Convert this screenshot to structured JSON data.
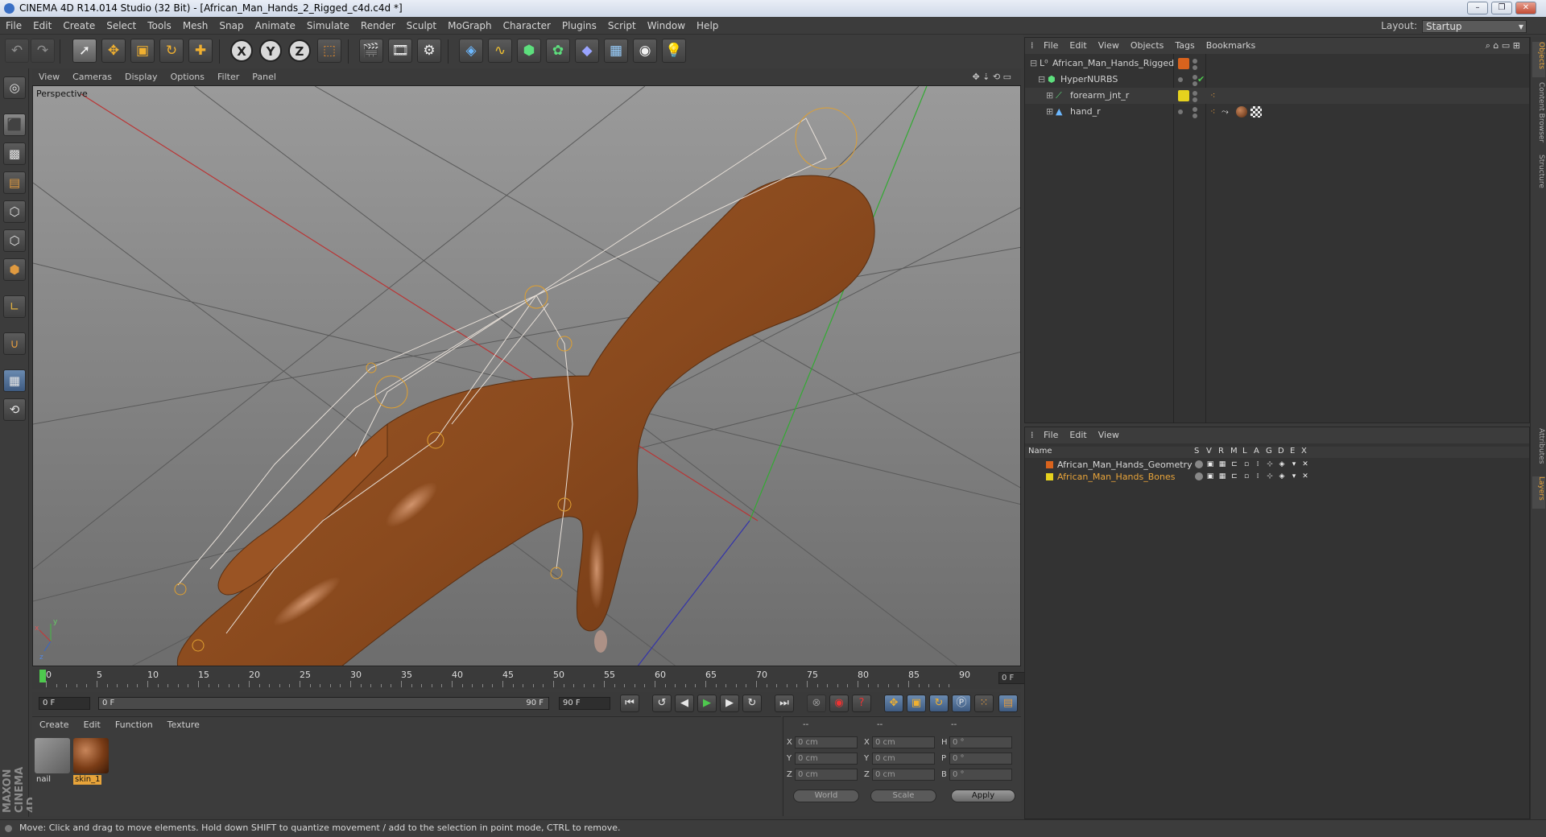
{
  "window": {
    "title": "CINEMA 4D R14.014 Studio (32 Bit) - [African_Man_Hands_2_Rigged_c4d.c4d *]",
    "minimize": "–",
    "maximize": "❐",
    "close": "✕"
  },
  "menubar": [
    "File",
    "Edit",
    "Create",
    "Select",
    "Tools",
    "Mesh",
    "Snap",
    "Animate",
    "Simulate",
    "Render",
    "Sculpt",
    "MoGraph",
    "Character",
    "Plugins",
    "Script",
    "Window",
    "Help"
  ],
  "layout": {
    "label": "Layout:",
    "value": "Startup"
  },
  "toolbar": {
    "x_axis": "X",
    "y_axis": "Y",
    "z_axis": "Z"
  },
  "viewport": {
    "menu": [
      "View",
      "Cameras",
      "Display",
      "Options",
      "Filter",
      "Panel"
    ],
    "label": "Perspective"
  },
  "timeline": {
    "ticks": [
      "0",
      "5",
      "10",
      "15",
      "20",
      "25",
      "30",
      "35",
      "40",
      "45",
      "50",
      "55",
      "60",
      "65",
      "70",
      "75",
      "80",
      "85",
      "90"
    ],
    "current_frame": "0 F"
  },
  "transport": {
    "start": "0 F",
    "range_start": "0 F",
    "range_end": "90 F",
    "end": "90 F"
  },
  "materials": {
    "menu": [
      "Create",
      "Edit",
      "Function",
      "Texture"
    ],
    "items": [
      {
        "name": "nail"
      },
      {
        "name": "skin_1"
      }
    ]
  },
  "coords": {
    "headers": [
      "--",
      "--",
      "--"
    ],
    "rows": [
      {
        "a": "X",
        "av": "0 cm",
        "b": "X",
        "bv": "0 cm",
        "c": "H",
        "cv": "0 °"
      },
      {
        "a": "Y",
        "av": "0 cm",
        "b": "Y",
        "bv": "0 cm",
        "c": "P",
        "cv": "0 °"
      },
      {
        "a": "Z",
        "av": "0 cm",
        "b": "Z",
        "bv": "0 cm",
        "c": "B",
        "cv": "0 °"
      }
    ],
    "world": "World",
    "scale": "Scale",
    "apply": "Apply"
  },
  "status": "Move: Click and drag to move elements. Hold down SHIFT to quantize movement / add to the selection in point mode, CTRL to remove.",
  "maxon": "MAXON CINEMA 4D",
  "object_manager": {
    "menu": [
      "File",
      "Edit",
      "View",
      "Objects",
      "Tags",
      "Bookmarks"
    ],
    "objects": [
      {
        "name": "African_Man_Hands_Rigged"
      },
      {
        "name": "HyperNURBS"
      },
      {
        "name": "forearm_jnt_r"
      },
      {
        "name": "hand_r"
      }
    ]
  },
  "layer_manager": {
    "menu": [
      "File",
      "Edit",
      "View"
    ],
    "columns": [
      "Name",
      "S",
      "V",
      "R",
      "M",
      "L",
      "A",
      "G",
      "D",
      "E",
      "X"
    ],
    "layers": [
      {
        "name": "African_Man_Hands_Geometry",
        "color": "#d9631d"
      },
      {
        "name": "African_Man_Hands_Bones",
        "color": "#e6d21e"
      }
    ]
  },
  "side_tabs": [
    "Objects",
    "Content Browser",
    "Structure",
    "Attributes",
    "Layers"
  ],
  "colors": {
    "accent": "#e8a43a",
    "skin": "#8a4a1e",
    "green_key": "#4ec94e"
  }
}
